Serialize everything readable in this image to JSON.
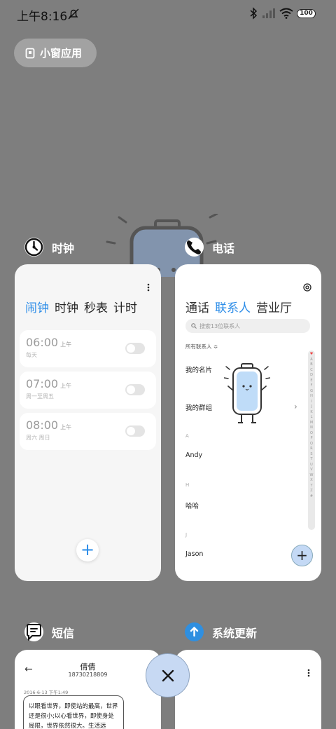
{
  "status_bar": {
    "time": "上午8:16",
    "battery": "100"
  },
  "float_window_label": "小窗应用",
  "clock_app": {
    "name": "时钟",
    "tabs": [
      "闹钟",
      "时钟",
      "秒表",
      "计时"
    ],
    "alarms": [
      {
        "time": "06:00",
        "ampm": "上午",
        "repeat": "每天"
      },
      {
        "time": "07:00",
        "ampm": "上午",
        "repeat": "周一至周五"
      },
      {
        "time": "08:00",
        "ampm": "上午",
        "repeat": "周六 周日"
      }
    ],
    "add_label": "+"
  },
  "phone_app": {
    "name": "电话",
    "tabs": [
      "通话",
      "联系人",
      "营业厅"
    ],
    "search_placeholder": "搜索13位联系人",
    "filter_label": "所有联系人 ≎",
    "my_card": "我的名片",
    "my_groups": "我的群组",
    "sections": [
      {
        "letter": "A",
        "contact": "Andy"
      },
      {
        "letter": "H",
        "contact": "哈哈"
      },
      {
        "letter": "J",
        "contact": "Jason"
      }
    ],
    "alphabet": [
      "♥",
      "A",
      "B",
      "C",
      "D",
      "E",
      "F",
      "G",
      "H",
      "I",
      "J",
      "K",
      "L",
      "M",
      "N",
      "O",
      "P",
      "Q",
      "R",
      "S",
      "T",
      "U",
      "V",
      "W",
      "X",
      "Y",
      "Z",
      "#"
    ],
    "add_label": "+"
  },
  "sms_app": {
    "name": "短信",
    "contact_name": "倩倩",
    "contact_number": "18730218809",
    "date": "2016-6-13 下午1:49",
    "message": "以眼看世界，即使站的最高，世界还是很小;以心看世界，即使身处局限，世界依然很大。生活远"
  },
  "update_app": {
    "name": "系统更新"
  },
  "colors": {
    "background": "#7e7e7e",
    "accent": "#2b8ce8",
    "close_button": "#c7d9f3"
  }
}
